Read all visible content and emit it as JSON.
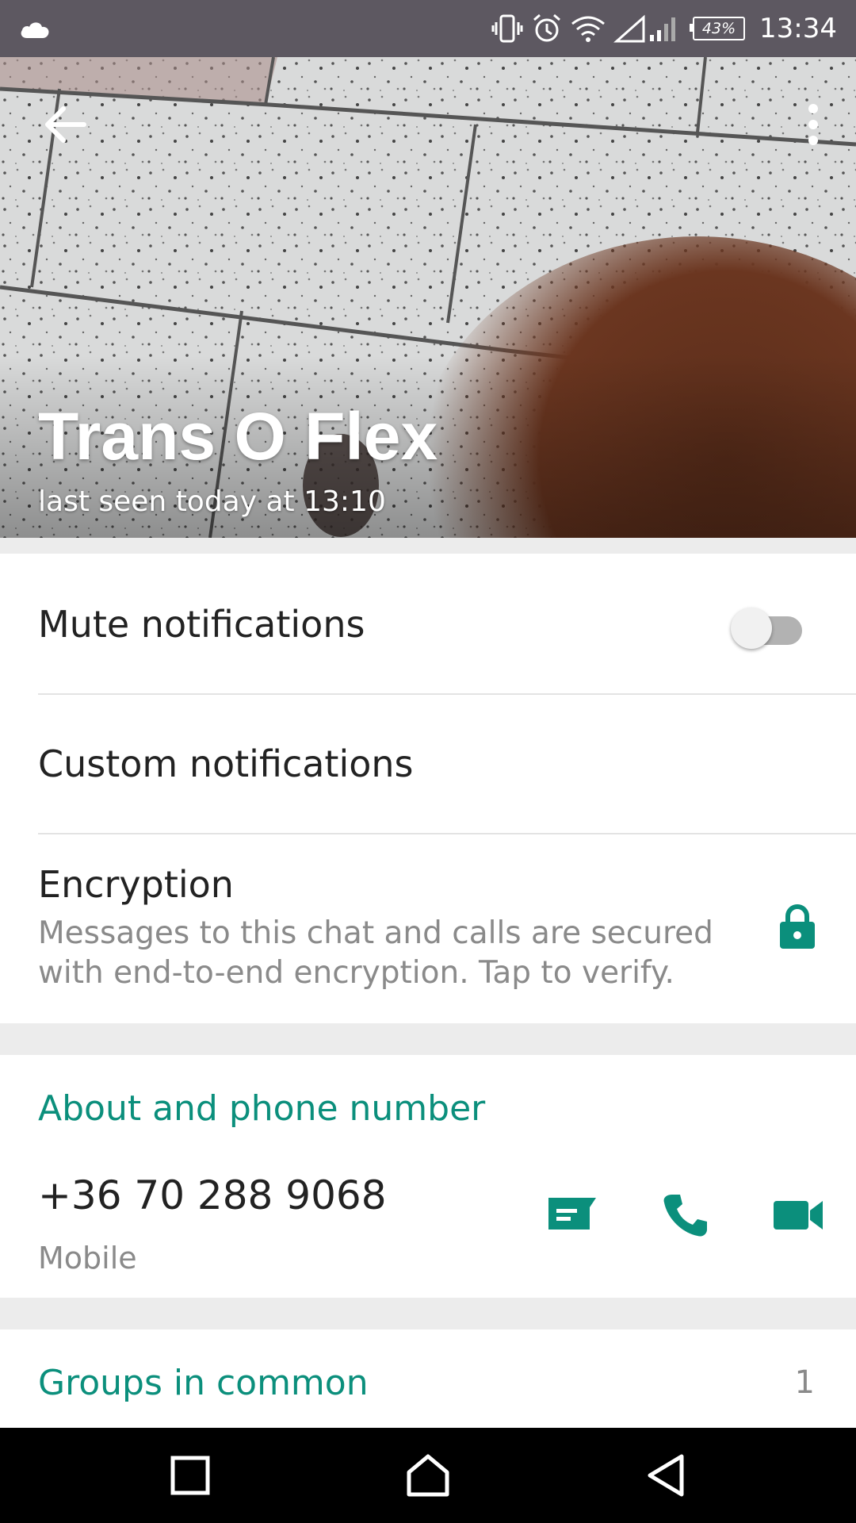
{
  "status_bar": {
    "battery": "43%",
    "time": "13:34",
    "icons": [
      "cloud-icon",
      "vibrate-icon",
      "alarm-icon",
      "wifi-icon",
      "signal-icon",
      "battery-icon"
    ]
  },
  "header": {
    "contact_name": "Trans O Flex",
    "last_seen": "last seen today at 13:10"
  },
  "settings": {
    "mute_label": "Mute notifications",
    "mute_enabled": false,
    "custom_label": "Custom notifications",
    "encryption_title": "Encryption",
    "encryption_desc": "Messages to this chat and calls are secured with end-to-end encryption. Tap to verify."
  },
  "about": {
    "section_title": "About and phone number",
    "phone_number": "+36 70 288 9068",
    "phone_type": "Mobile",
    "actions": [
      "message-icon",
      "call-icon",
      "video-call-icon"
    ]
  },
  "groups": {
    "label": "Groups in common",
    "count": "1"
  },
  "colors": {
    "accent": "#0b8f7c",
    "status_bar": "#5d5861"
  }
}
